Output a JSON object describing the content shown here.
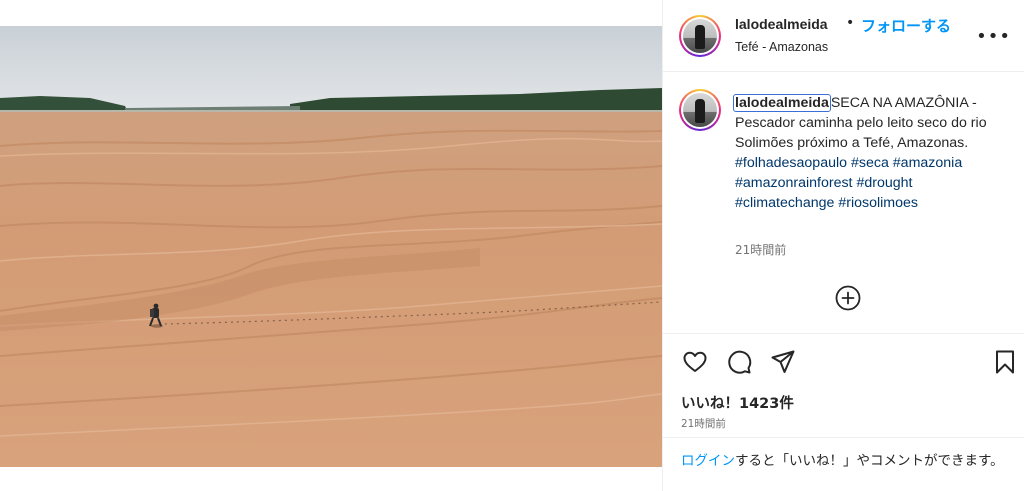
{
  "post": {
    "username": "lalodealmeida",
    "dot": "•",
    "follow_label": "フォローする",
    "location": "Tefé - Amazonas",
    "more_label": "•••"
  },
  "caption": {
    "username": "lalodealmeida",
    "text": "SECA NA AMAZÔNIA - Pescador caminha pelo leito seco do rio Solimões próximo a Tefé, Amazonas. ",
    "hashtags": [
      "#folhadesaopaulo",
      "#seca",
      "#amazonia",
      "#amazonrainforest",
      "#drought",
      "#climatechange",
      "#riosolimoes"
    ],
    "time": "21時間前"
  },
  "stats": {
    "likes": "いいね！1423件",
    "time": "21時間前"
  },
  "footer": {
    "login_link": "ログイン",
    "login_text": "すると「いいね！」やコメントができます。"
  },
  "colors": {
    "accent": "#0095f6",
    "hashtag": "#00376b",
    "sand": "#d49d76",
    "sky": "#dce2e6",
    "forest": "#2f4a33"
  },
  "icons": [
    "more-icon",
    "add-comment-icon",
    "heart-icon",
    "comment-icon",
    "share-icon",
    "bookmark-icon"
  ]
}
